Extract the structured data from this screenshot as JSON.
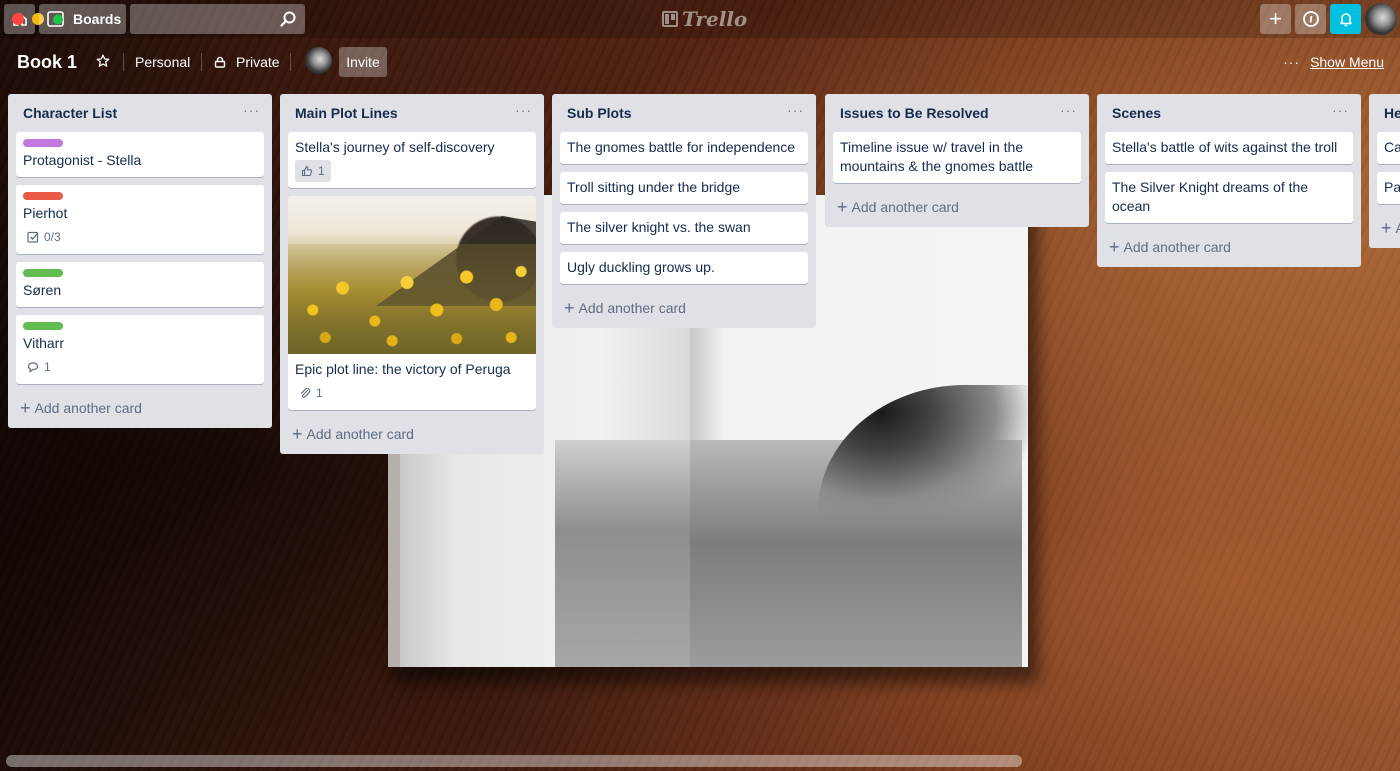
{
  "header": {
    "boards_label": "Boards",
    "search_value": "",
    "logo_text": "Trello",
    "buttons": {
      "create": "+",
      "info": "i"
    }
  },
  "board": {
    "title": "Book 1",
    "team": "Personal",
    "visibility": "Private",
    "invite_label": "Invite",
    "show_menu_dots": "···",
    "show_menu_label": "Show Menu"
  },
  "colors": {
    "label_purple": "#c377e0",
    "label_red": "#eb5a46",
    "label_green": "#61bd4f",
    "notification_accent": "#00c2e0"
  },
  "lists": [
    {
      "title": "Character List",
      "menu": "···",
      "cards": [
        {
          "label_color": "#c377e0",
          "title": "Protagonist - Stella"
        },
        {
          "label_color": "#eb5a46",
          "title": "Pierhot",
          "badge": {
            "type": "checklist",
            "text": "0/3"
          }
        },
        {
          "label_color": "#61bd4f",
          "title": "Søren"
        },
        {
          "label_color": "#61bd4f",
          "title": "Vitharr",
          "badge": {
            "type": "comments",
            "text": "1"
          }
        }
      ],
      "add_label": "Add another card"
    },
    {
      "title": "Main Plot Lines",
      "menu": "···",
      "cards": [
        {
          "title": "Stella's journey of self-discovery",
          "badge": {
            "type": "votes",
            "text": "1"
          }
        },
        {
          "cover": "yellow-flowers-photo",
          "title": "Epic plot line: the victory of Peruga",
          "badge": {
            "type": "attachments",
            "text": "1"
          }
        }
      ],
      "add_label": "Add another card"
    },
    {
      "title": "Sub Plots",
      "menu": "···",
      "cards": [
        {
          "title": "The gnomes battle for independence"
        },
        {
          "title": "Troll sitting under the bridge"
        },
        {
          "title": "The silver knight vs. the swan"
        },
        {
          "title": "Ugly duckling grows up."
        }
      ],
      "add_label": "Add another card"
    },
    {
      "title": "Issues to Be Resolved",
      "menu": "···",
      "cards": [
        {
          "title": "Timeline issue w/ travel in the mountains & the gnomes battle"
        }
      ],
      "add_label": "Add another card"
    },
    {
      "title": "Scenes",
      "menu": "···",
      "cards": [
        {
          "title": "Stella's battle of wits against the troll"
        },
        {
          "title": "The Silver Knight dreams of the ocean"
        }
      ],
      "add_label": "Add another card"
    },
    {
      "title": "He",
      "menu": "",
      "cards": [
        {
          "title": "Ca"
        },
        {
          "title": "Pa"
        }
      ],
      "add_label": "A"
    }
  ],
  "add_plus": "+"
}
